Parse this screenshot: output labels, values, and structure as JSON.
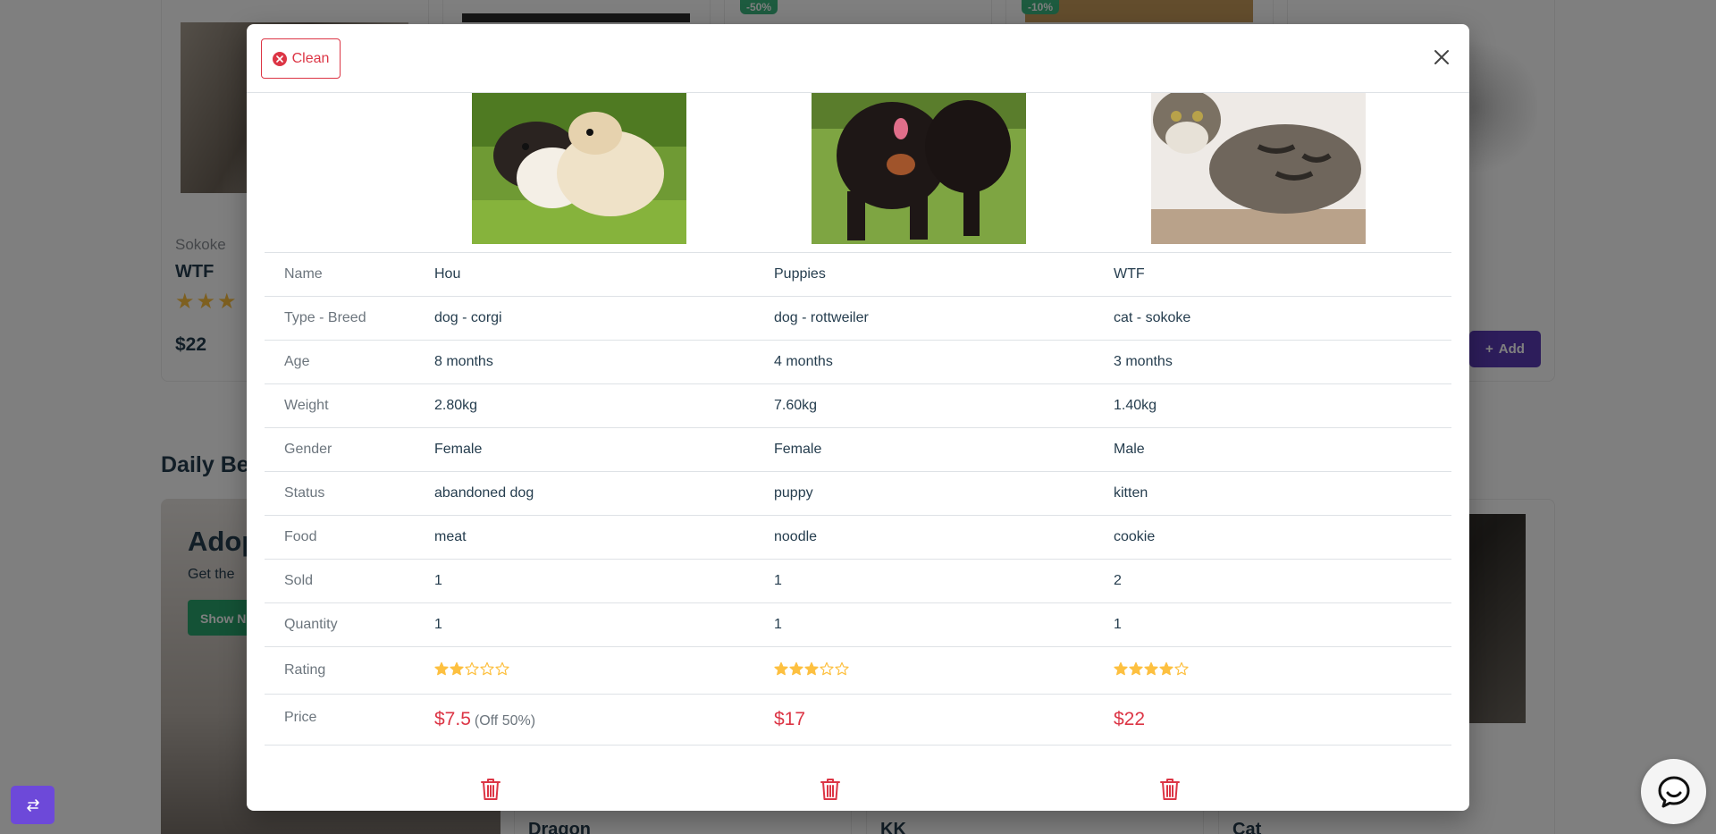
{
  "background": {
    "cards": [
      {
        "brand": "Sokoke",
        "name": "WTF",
        "price": "$22"
      }
    ],
    "badges": [
      "-50%",
      "-10%"
    ],
    "add_label": "Add",
    "section_title": "Daily Bes",
    "banner": {
      "title": "Adop",
      "subtitle": "Get the",
      "button": "Show N"
    },
    "bottom_cards": [
      "Dragon",
      "KK",
      "Cat"
    ]
  },
  "modal": {
    "clean_label": "Clean",
    "pets": [
      {
        "name": "Hou",
        "type_breed": "dog - corgi",
        "age": "8 months",
        "weight": "2.80kg",
        "gender": "Female",
        "status": "abandoned dog",
        "food": "meat",
        "sold": "1",
        "quantity": "1",
        "rating": 2,
        "price": "$7.5",
        "off": "(Off 50%)"
      },
      {
        "name": "Puppies",
        "type_breed": "dog - rottweiler",
        "age": "4 months",
        "weight": "7.60kg",
        "gender": "Female",
        "status": "puppy",
        "food": "noodle",
        "sold": "1",
        "quantity": "1",
        "rating": 3,
        "price": "$17",
        "off": ""
      },
      {
        "name": "WTF",
        "type_breed": "cat - sokoke",
        "age": "3 months",
        "weight": "1.40kg",
        "gender": "Male",
        "status": "kitten",
        "food": "cookie",
        "sold": "2",
        "quantity": "1",
        "rating": 4,
        "price": "$22",
        "off": ""
      }
    ],
    "labels": {
      "name": "Name",
      "type_breed": "Type - Breed",
      "age": "Age",
      "weight": "Weight",
      "gender": "Gender",
      "status": "Status",
      "food": "Food",
      "sold": "Sold",
      "quantity": "Quantity",
      "rating": "Rating",
      "price": "Price"
    }
  },
  "colors": {
    "accent_red": "#dc3545",
    "star": "#fdc040",
    "brand_purple": "#6d49d9",
    "green": "#3bb77e"
  }
}
